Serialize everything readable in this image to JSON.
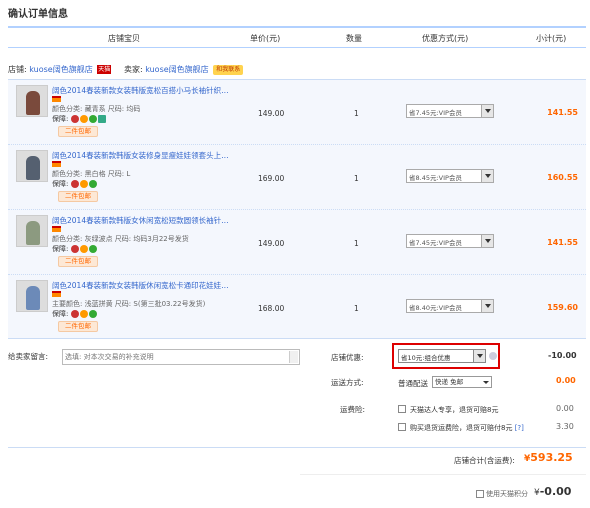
{
  "page_title": "确认订单信息",
  "columns": [
    "店铺宝贝",
    "单价(元)",
    "数量",
    "优惠方式(元)",
    "小计(元)"
  ],
  "shop": {
    "shop_label": "店铺:",
    "shop_name": "kuose阔色旗舰店",
    "tmall_badge": "天猫",
    "seller_label": "卖家:",
    "seller_name": "kuose阔色旗舰店",
    "ww_badge": "和我联系"
  },
  "items": [
    {
      "title": "阔色2014春装新款女装韩版宽松百搭小马长袖针织…",
      "props": "颜色分类: 藏青系   尺码: 均码",
      "guarantee": "保障:",
      "ship_badge": "二件包邮",
      "price": "149.00",
      "qty": "1",
      "promo": "省7.45元:VIP会员",
      "subtotal": "141.55",
      "thumb_color": "#7a4a3c"
    },
    {
      "title": "阔色2014春装新款韩版女装修身显瘦娃娃领套头上…",
      "props": "颜色分类: 黑白格   尺码: L",
      "guarantee": "保障:",
      "ship_badge": "二件包邮",
      "price": "169.00",
      "qty": "1",
      "promo": "省8.45元:VIP会员",
      "subtotal": "160.55",
      "thumb_color": "#556070"
    },
    {
      "title": "阔色2014春装新款韩版女休闲宽松短款圆领长袖针…",
      "props": "颜色分类: 灰绿波点   尺码: 均码3月22号发货",
      "guarantee": "保障:",
      "ship_badge": "二件包邮",
      "price": "149.00",
      "qty": "1",
      "promo": "省7.45元:VIP会员",
      "subtotal": "141.55",
      "thumb_color": "#8c9a80"
    },
    {
      "title": "阔色2014春装新款女装韩版休闲宽松卡通印花娃娃…",
      "props": "主要颜色: 浅蓝拼黄   尺码: S(第三批03.22号发货)",
      "guarantee": "保障:",
      "ship_badge": "二件包邮",
      "price": "168.00",
      "qty": "1",
      "promo": "省8.40元:VIP会员",
      "subtotal": "159.60",
      "thumb_color": "#6c8ab8"
    }
  ],
  "message": {
    "label": "给卖家留言:",
    "placeholder": "选填: 对本次交易的补充说明"
  },
  "shop_promo": {
    "label": "店铺优惠:",
    "value": "省10元:组合优惠",
    "amount": "-10.00"
  },
  "shipping": {
    "label": "运送方式:",
    "type": "普通配送",
    "option": "快递 免邮",
    "amount": "0.00"
  },
  "insurance": {
    "label": "运费险:",
    "opt1": "天猫达人专享，退货可赔8元",
    "opt1_amount": "0.00",
    "opt2": "购买退货运费险，退货可赔付8元",
    "opt2_help": "[?]",
    "opt2_amount": "3.30"
  },
  "total": {
    "label": "店铺合计(含运费):",
    "currency": "¥",
    "value": "593.25"
  },
  "points": {
    "label": "使用天猫积分",
    "currency": "¥",
    "value": "-0.00"
  },
  "colors": {
    "accent": "#ff6600",
    "link": "#3366cc",
    "border": "#b2d1ff",
    "highlight": "#dd0000"
  }
}
